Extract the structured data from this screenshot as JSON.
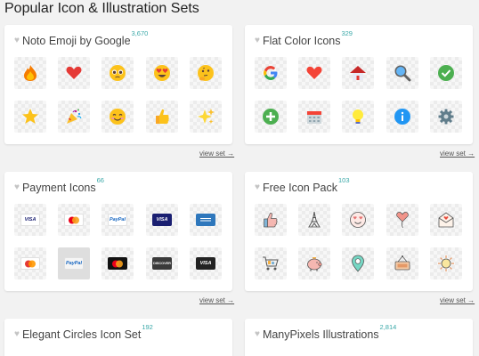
{
  "page": {
    "title": "Popular Icon & Illustration Sets"
  },
  "cards": [
    {
      "title": "Noto Emoji by Google",
      "count": "3,670",
      "view_set": "view set →"
    },
    {
      "title": "Flat Color Icons",
      "count": "329",
      "view_set": "view set →"
    },
    {
      "title": "Payment Icons",
      "count": "66",
      "view_set": "view set →"
    },
    {
      "title": "Free Icon Pack",
      "count": "103",
      "view_set": "view set →"
    },
    {
      "title": "Elegant Circles Icon Set",
      "count": "192"
    },
    {
      "title": "ManyPixels Illustrations",
      "count": "2,814"
    }
  ],
  "icon_names": {
    "noto": [
      "fire-icon",
      "red-heart-icon",
      "pleading-face-icon",
      "heart-eyes-face-icon",
      "thinking-face-icon",
      "star-icon",
      "party-popper-icon",
      "smiling-face-icon",
      "thumbs-up-icon",
      "sparkles-icon"
    ],
    "flat": [
      "google-g-icon",
      "heart-icon",
      "home-icon",
      "search-icon",
      "checkmark-icon",
      "add-icon",
      "calendar-icon",
      "idea-bulb-icon",
      "info-icon",
      "settings-gear-icon"
    ],
    "payment": [
      "visa-icon",
      "mastercard-icon",
      "paypal-icon",
      "visa-blue-icon",
      "amex-icon",
      "maestro-icon",
      "paypal-light-icon",
      "mastercard-dark-icon",
      "discover-icon",
      "visa-dark-icon"
    ],
    "freepack": [
      "thumbs-up-icon",
      "eiffel-tower-icon",
      "love-face-icon",
      "heart-balloon-icon",
      "love-letter-icon",
      "shopping-cart-icon",
      "piggy-bank-icon",
      "location-pin-icon",
      "open-sign-icon",
      "sun-icon"
    ]
  },
  "payment_text": {
    "visa": "VISA",
    "paypal": "PayPal",
    "discover": "DISCOVER"
  },
  "colors": {
    "count_teal": "#3aa8a8",
    "background": "#f2f2f2"
  }
}
